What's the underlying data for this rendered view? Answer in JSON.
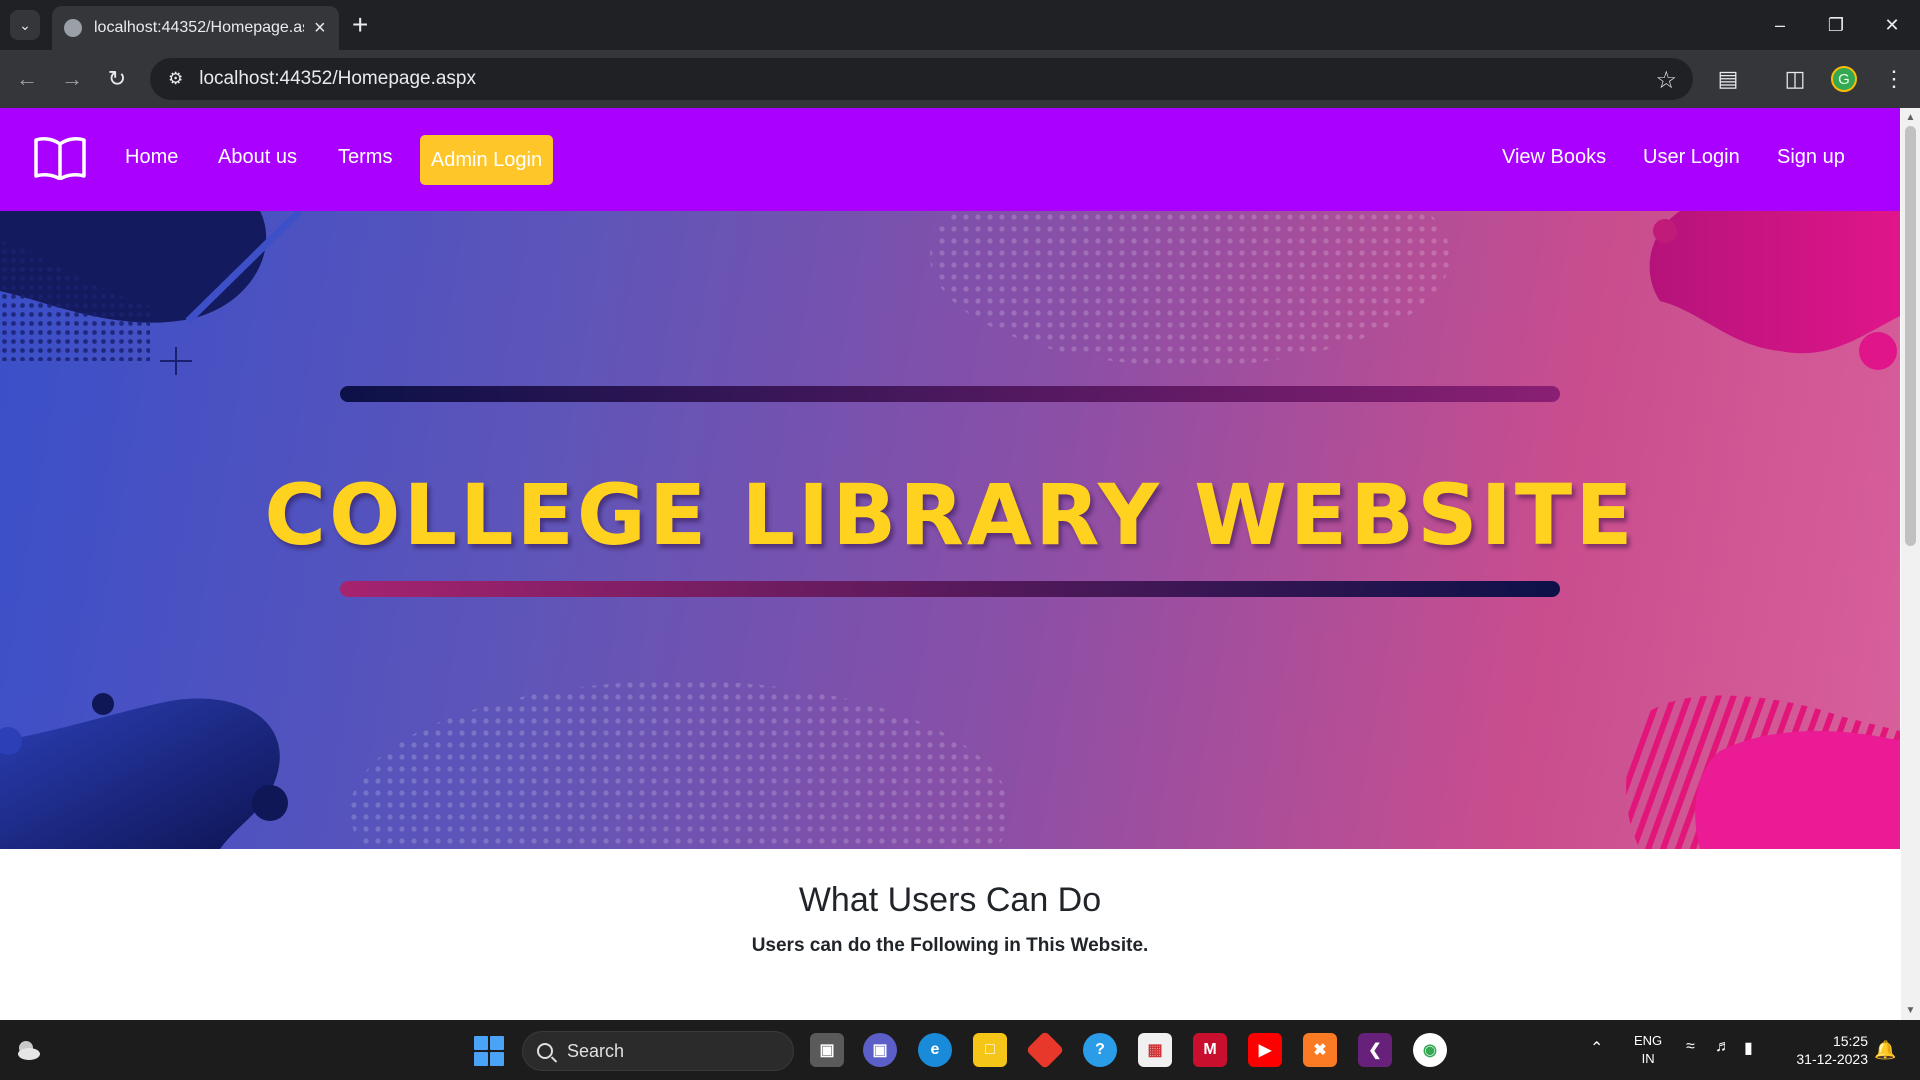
{
  "browser": {
    "tab_title": "localhost:44352/Homepage.asp",
    "url": "localhost:44352/Homepage.aspx",
    "profile_initial": "G"
  },
  "site": {
    "nav_left": [
      "Home",
      "About us",
      "Terms"
    ],
    "admin_login": "Admin Login",
    "nav_right": [
      "View Books",
      "User Login",
      "Sign up"
    ],
    "brand_color": "#aa00ff",
    "admin_color": "#ffc629"
  },
  "hero": {
    "title": "COLLEGE LIBRARY WEBSITE"
  },
  "features": {
    "title": "What Users Can Do",
    "subtitle": "Users can do the Following in This Website."
  },
  "taskbar": {
    "search_placeholder": "Search",
    "lang_line1": "ENG",
    "lang_line2": "IN",
    "time": "15:25",
    "date": "31-12-2023"
  }
}
